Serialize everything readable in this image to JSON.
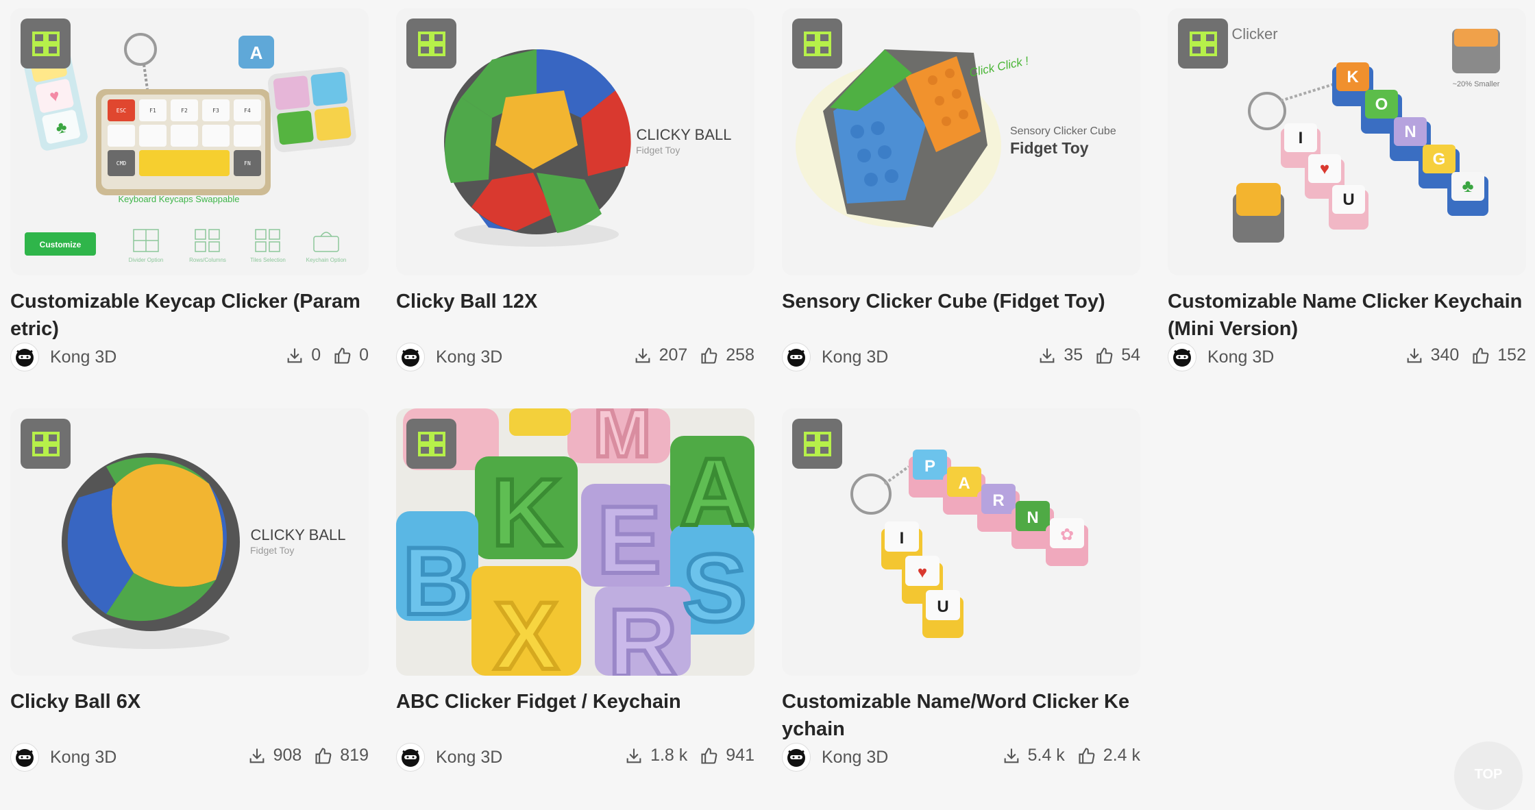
{
  "cards": [
    {
      "title": "Customizable Keycap Clicker (Parametric)",
      "author": "Kong 3D",
      "downloads": "0",
      "likes": "0",
      "art": {
        "caption": "Keyboard Keycaps Swappable",
        "button": "Customize",
        "options": [
          "Divider Option",
          "Rows/Columns",
          "Tiles Selection",
          "Keychain Option"
        ],
        "keys": [
          "ESC",
          "F1",
          "F2",
          "F3",
          "F4",
          "CMD",
          "FN"
        ],
        "letter": "A"
      }
    },
    {
      "title": "Clicky Ball 12X",
      "author": "Kong 3D",
      "downloads": "207",
      "likes": "258",
      "art": {
        "line1": "CLICKY BALL",
        "line2": "Fidget Toy"
      }
    },
    {
      "title": "Sensory Clicker Cube (Fidget Toy)",
      "author": "Kong 3D",
      "downloads": "35",
      "likes": "54",
      "art": {
        "line1": "Sensory Clicker Cube",
        "line2": "Fidget Toy",
        "tag": "Click Click !"
      }
    },
    {
      "title": "Customizable Name Clicker Keychain (Mini Version)",
      "author": "Kong 3D",
      "downloads": "340",
      "likes": "152",
      "art": {
        "corner": "e Clicker",
        "note": "~20% Smaller",
        "letters": [
          "K",
          "O",
          "N",
          "G"
        ],
        "letters2": [
          "I",
          "U"
        ]
      }
    },
    {
      "title": "Clicky Ball 6X",
      "author": "Kong 3D",
      "downloads": "908",
      "likes": "819",
      "art": {
        "line1": "CLICKY BALL",
        "line2": "Fidget Toy"
      }
    },
    {
      "title": "ABC Clicker Fidget / Keychain",
      "author": "Kong 3D",
      "downloads": "1.8 k",
      "likes": "941",
      "art": {
        "letters": [
          "K",
          "E",
          "S",
          "B",
          "X",
          "R",
          "A",
          "M"
        ]
      }
    },
    {
      "title": "Customizable Name/Word Clicker Keychain",
      "author": "Kong 3D",
      "downloads": "5.4 k",
      "likes": "2.4 k",
      "art": {
        "letters": [
          "P",
          "A",
          "R",
          "N"
        ],
        "letters2": [
          "I",
          "U"
        ]
      }
    }
  ],
  "back_to_top": "TOP",
  "colors": {
    "badge_bg": "#707070",
    "badge_icon": "#b6f04a",
    "accent_green": "#2fb54a"
  },
  "icons": {
    "badge": "model-grid-icon",
    "download": "download-icon",
    "like": "thumbs-up-icon",
    "avatar": "ninja-avatar-icon"
  }
}
